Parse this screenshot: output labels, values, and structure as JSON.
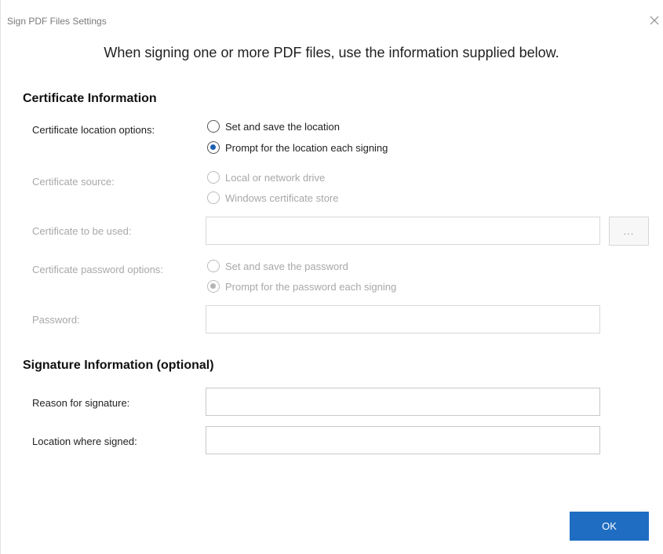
{
  "dialog": {
    "title": "Sign PDF Files Settings",
    "intro": "When signing one or more PDF files, use the information supplied below."
  },
  "certificate": {
    "heading": "Certificate Information",
    "location_label": "Certificate location options:",
    "location_options": [
      {
        "label": "Set and save the location",
        "selected": false
      },
      {
        "label": "Prompt for the location each signing",
        "selected": true
      }
    ],
    "source_label": "Certificate source:",
    "source_options": [
      {
        "label": "Local or network drive",
        "selected": false
      },
      {
        "label": "Windows certificate store",
        "selected": false
      }
    ],
    "to_be_used_label": "Certificate to be used:",
    "to_be_used_value": "",
    "browse_label": "...",
    "password_options_label": "Certificate password options:",
    "password_options": [
      {
        "label": "Set and save the password",
        "selected": false
      },
      {
        "label": "Prompt for the password each signing",
        "selected": true
      }
    ],
    "password_label": "Password:",
    "password_value": ""
  },
  "signature": {
    "heading": "Signature Information (optional)",
    "reason_label": "Reason for signature:",
    "reason_value": "",
    "location_label": "Location where signed:",
    "location_value": ""
  },
  "footer": {
    "ok_label": "OK"
  },
  "colors": {
    "accent": "#1e6dc2",
    "disabled_text": "#a8a8a8"
  },
  "icons": {
    "close": "close-icon"
  }
}
